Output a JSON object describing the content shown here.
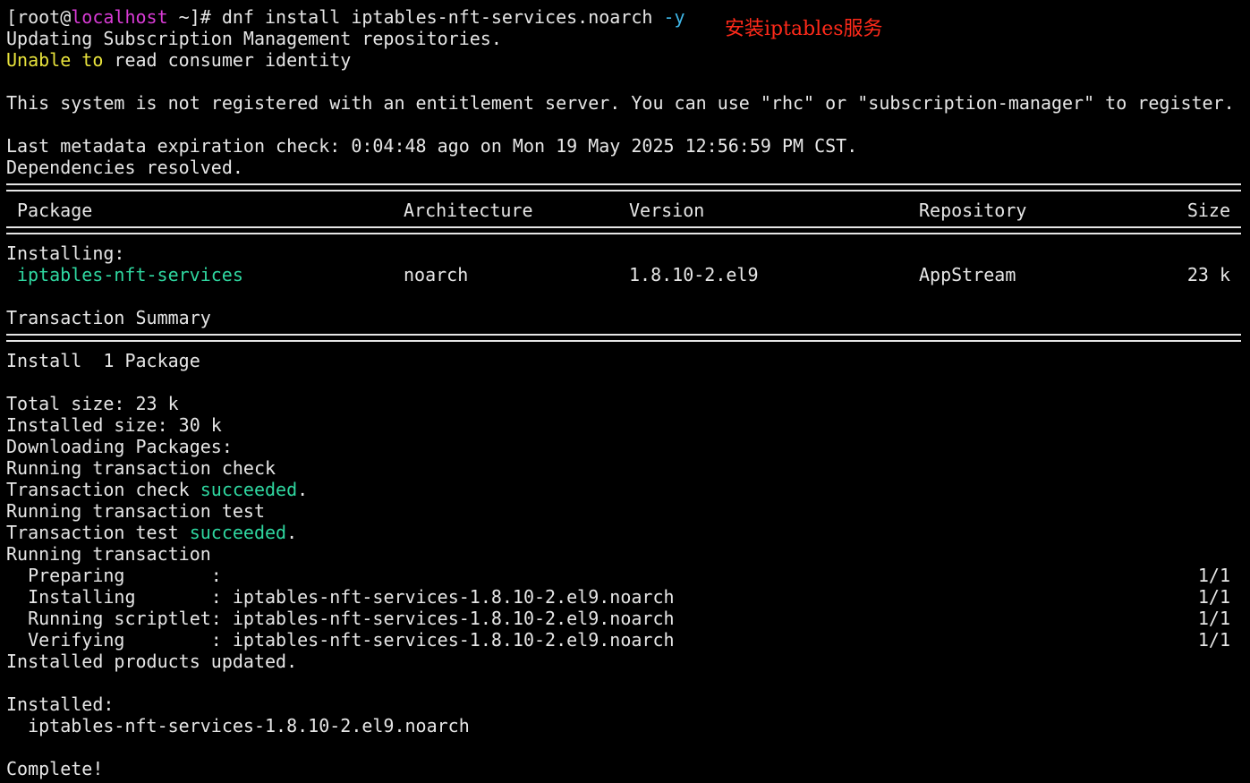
{
  "prompt": {
    "open": "[root@",
    "host": "localhost",
    "rest": " ~]# dnf install iptables-nft-services.noarch ",
    "flag": "-y"
  },
  "annotation": "安装iptables服务",
  "lines": {
    "updating": "Updating Subscription Management repositories.",
    "unable_word": "Unable",
    "to_word": "to",
    "unable_rest": " read consumer identity",
    "not_registered": "This system is not registered with an entitlement server. You can use \"rhc\" or \"subscription-manager\" to register.",
    "metadata": "Last metadata expiration check: 0:04:48 ago on Mon 19 May 2025 12:56:59 PM CST.",
    "deps": "Dependencies resolved.",
    "installing_hdr": "Installing:",
    "txn_summary": "Transaction Summary",
    "install_count": "Install  1 Package",
    "total_size": "Total size: 23 k",
    "installed_size": "Installed size: 30 k",
    "downloading": "Downloading Packages:",
    "run_check": "Running transaction check",
    "check_prefix": "Transaction check ",
    "check_result": "succeeded",
    "check_dot": ".",
    "run_test": "Running transaction test",
    "test_prefix": "Transaction test ",
    "test_result": "succeeded",
    "test_dot": ".",
    "run_txn": "Running transaction",
    "products_updated": "Installed products updated.",
    "installed_hdr": "Installed:",
    "installed_pkg": "  iptables-nft-services-1.8.10-2.el9.noarch",
    "complete": "Complete!"
  },
  "table": {
    "headers": {
      "package": "Package",
      "architecture": "Architecture",
      "version": "Version",
      "repository": "Repository",
      "size": "Size"
    },
    "row": {
      "package": "iptables-nft-services",
      "architecture": "noarch",
      "version": "1.8.10-2.el9",
      "repository": "AppStream",
      "size": "23 k"
    }
  },
  "steps": [
    {
      "label": "  Preparing        :",
      "detail": "",
      "progress": "1/1"
    },
    {
      "label": "  Installing       :",
      "detail": " iptables-nft-services-1.8.10-2.el9.noarch",
      "progress": "1/1"
    },
    {
      "label": "  Running scriptlet:",
      "detail": " iptables-nft-services-1.8.10-2.el9.noarch",
      "progress": "1/1"
    },
    {
      "label": "  Verifying        :",
      "detail": " iptables-nft-services-1.8.10-2.el9.noarch",
      "progress": "1/1"
    }
  ],
  "colors": {
    "background": "#000000",
    "foreground": "#e6e6e6",
    "hostname": "#d93bd6",
    "flag": "#3fb7e8",
    "warning": "#e8e33c",
    "success": "#2fd7a0",
    "annotation": "#ff2a1a"
  }
}
